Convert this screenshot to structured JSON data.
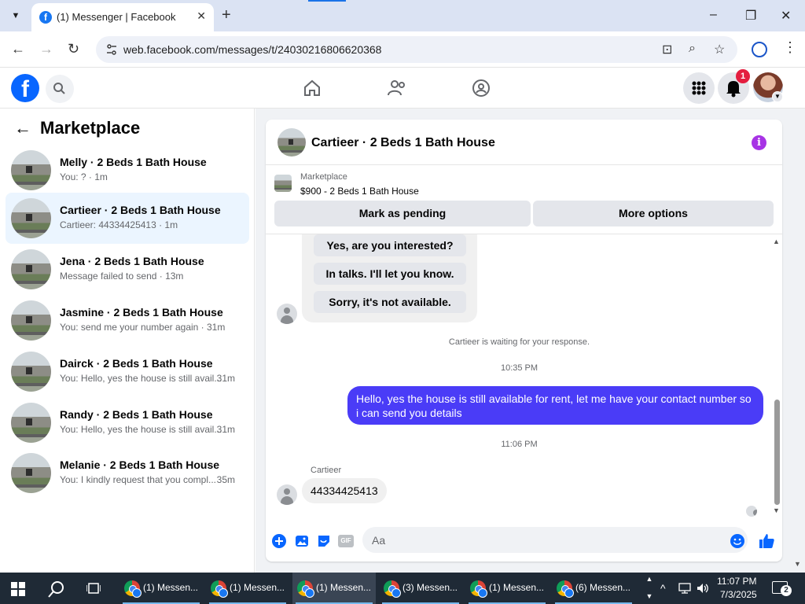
{
  "browser": {
    "tab_title": "(1) Messenger | Facebook",
    "tab_close": "✕",
    "new_tab": "+",
    "url": "web.facebook.com/messages/t/24030216806620368",
    "window_controls": [
      "–",
      "❐",
      "✕"
    ]
  },
  "fb_header": {
    "notification_count": "1"
  },
  "sidebar": {
    "title": "Marketplace",
    "conversations": [
      {
        "name": "Melly · 2 Beds 1 Bath House",
        "snippet": "You: ? · 1m",
        "time": "",
        "active": false
      },
      {
        "name": "Cartieer · 2 Beds 1 Bath House",
        "snippet": "Cartieer: 44334425413 · 1m",
        "time": "",
        "active": true
      },
      {
        "name": "Jena · 2 Beds 1 Bath House",
        "snippet": "Message failed to send · 13m",
        "time": "",
        "active": false
      },
      {
        "name": "Jasmine · 2 Beds 1 Bath House",
        "snippet": "You: send me your number again · 31m",
        "time": "",
        "active": false
      },
      {
        "name": "Dairck · 2 Beds 1 Bath House",
        "snippet": "You: Hello, yes the house is still avail...",
        "time": "31m",
        "active": false
      },
      {
        "name": "Randy · 2 Beds 1 Bath House",
        "snippet": "You: Hello, yes the house is still avail...",
        "time": "31m",
        "active": false
      },
      {
        "name": "Melanie · 2 Beds 1 Bath House",
        "snippet": "You: I kindly request that you compl...",
        "time": "35m",
        "active": false
      }
    ]
  },
  "chat": {
    "title": "Cartieer · 2 Beds 1 Bath House",
    "listing_label": "Marketplace",
    "listing_price": "$900 - 2 Beds 1 Bath House",
    "mark_pending": "Mark as pending",
    "more_options": "More options",
    "quick_replies": [
      "Yes, are you interested?",
      "In talks. I'll let you know.",
      "Sorry, it's not available."
    ],
    "waiting_text": "Cartieer is waiting for your response.",
    "time_1": "10:35 PM",
    "outgoing_message": "Hello, yes the house is still available for rent, let me have your contact number so i can send you  details",
    "time_2": "11:06 PM",
    "sender_name": "Cartieer",
    "incoming_message": "44334425413",
    "composer_placeholder": "Aa",
    "gif_label": "GIF"
  },
  "taskbar": {
    "items": [
      {
        "label": "(1) Messen...",
        "active": false
      },
      {
        "label": "(1) Messen...",
        "active": false
      },
      {
        "label": "(1) Messen...",
        "active": true
      },
      {
        "label": "(3) Messen...",
        "active": false
      },
      {
        "label": "(1) Messen...",
        "active": false
      },
      {
        "label": "(6) Messen...",
        "active": false
      }
    ],
    "time": "11:07 PM",
    "date": "7/3/2025",
    "notification_count": "2"
  },
  "colors": {
    "facebook_blue": "#0866ff",
    "outgoing_bubble": "#4a3cf7",
    "info_purple": "#a733e5",
    "active_row": "#ebf5ff"
  }
}
